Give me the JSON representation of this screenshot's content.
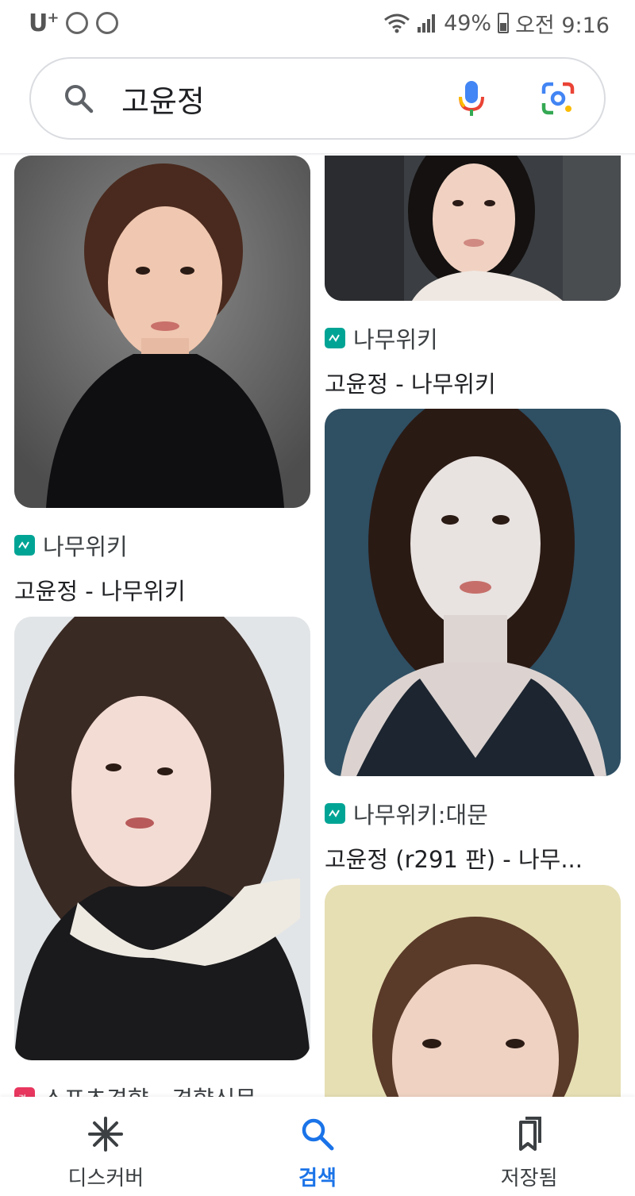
{
  "status_bar": {
    "carrier": "U",
    "carrier_sup": "+",
    "battery": "49%",
    "time": "오전 9:16"
  },
  "search": {
    "query": "고윤정"
  },
  "results": [
    {
      "source": "나무위키",
      "title": "고윤정 - 나무위키",
      "favicon": "namuwiki-icon"
    },
    {
      "source": "나무위키",
      "title": "고윤정 - 나무위키",
      "favicon": "namuwiki-icon"
    },
    {
      "source": "나무위키:대문",
      "title": "고윤정 (r291 판) - 나무...",
      "favicon": "namuwiki-icon"
    },
    {
      "source": "스포츠경향 - 경향신문",
      "title": "",
      "favicon": "sportskh-icon"
    }
  ],
  "bottom_nav": [
    {
      "label": "디스커버",
      "icon": "asterisk-icon"
    },
    {
      "label": "검색",
      "icon": "search-icon"
    },
    {
      "label": "저장됨",
      "icon": "bookmark-icon"
    }
  ],
  "colors": {
    "accent": "#1a73e8",
    "namuwiki": "#00a495",
    "sportskh": "#e8375f"
  }
}
